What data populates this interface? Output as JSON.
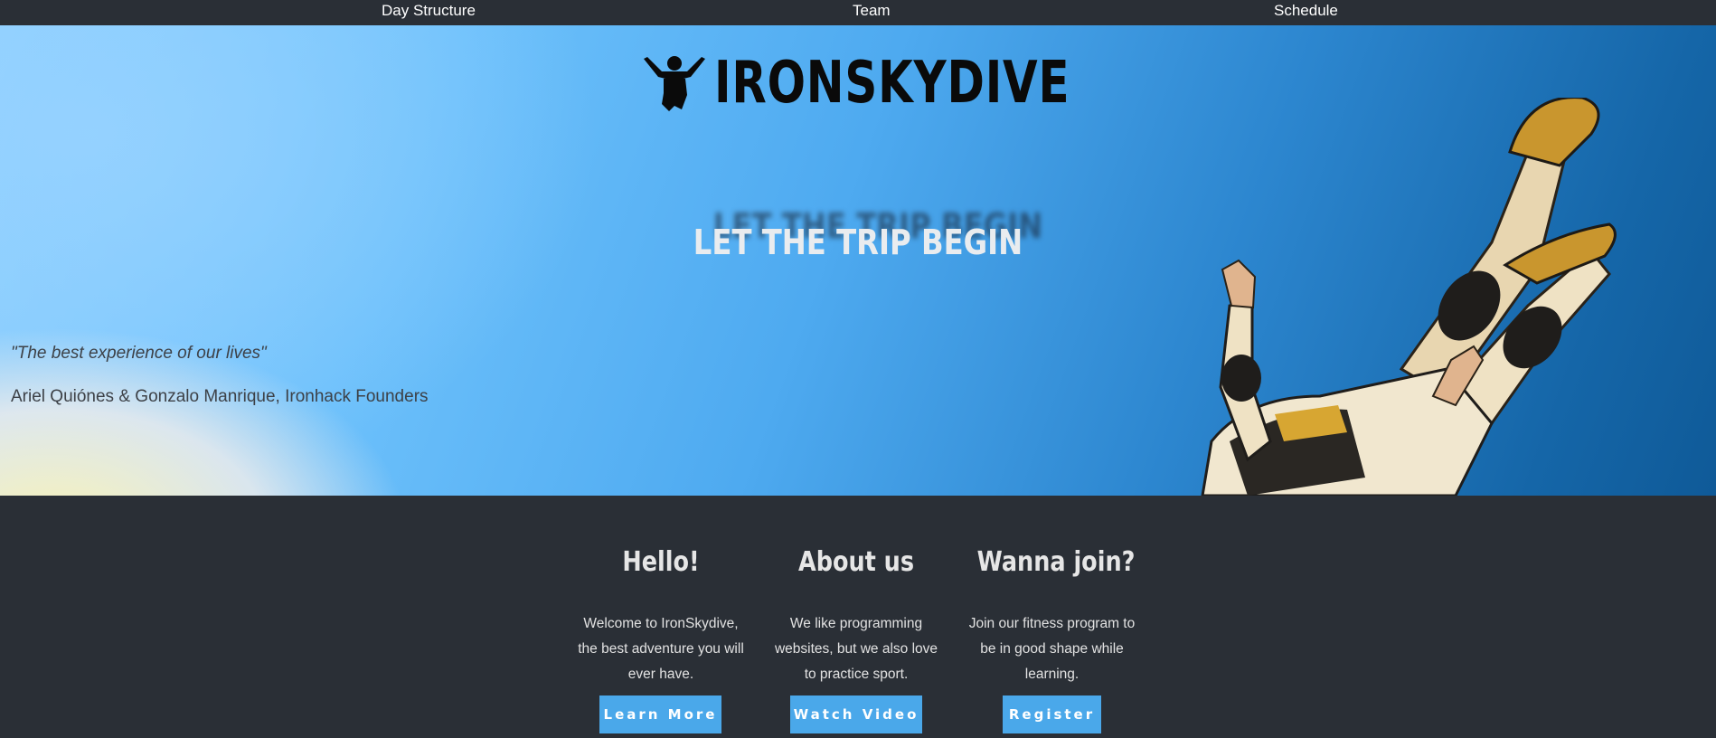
{
  "nav": {
    "items": [
      {
        "label": "Day Structure"
      },
      {
        "label": "Team"
      },
      {
        "label": "Schedule"
      }
    ]
  },
  "hero": {
    "logo_text": "IRONSKYDIVE",
    "logo_icon": "skydiver-icon",
    "headline": "LET THE TRIP BEGIN",
    "quote": "\"The best experience of our lives\"",
    "author": "Ariel Quiónes & Gonzalo Manrique, Ironhack Founders"
  },
  "features": [
    {
      "title": "Hello!",
      "text": "Welcome to IronSkydive, the best adventure you will ever have.",
      "button": "Learn More"
    },
    {
      "title": "About us",
      "text": "We like programming websites, but we also love to practice sport.",
      "button": "Watch Video"
    },
    {
      "title": "Wanna join?",
      "text": "Join our fitness program to be in good shape while learning.",
      "button": "Register"
    }
  ],
  "colors": {
    "background": "#2a2f36",
    "accent": "#4aa8ea",
    "sky": "#4eaaf0"
  }
}
